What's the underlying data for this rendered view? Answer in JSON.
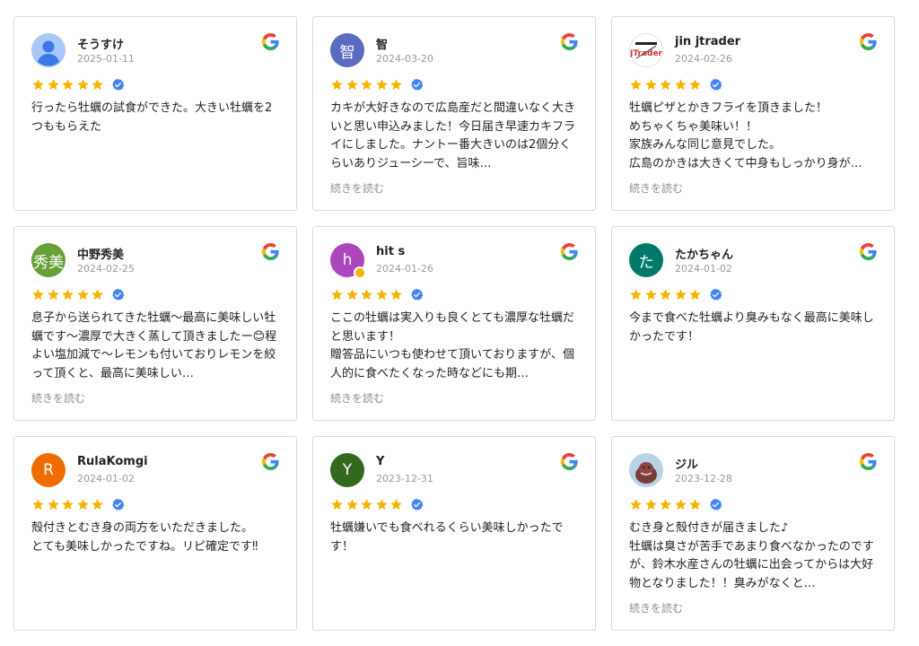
{
  "reviews": [
    {
      "name": "そうすけ",
      "date": "2025-01-11",
      "avatar": {
        "type": "default-user",
        "bg": "#a8c7fa",
        "initial": ""
      },
      "rating": 5,
      "text": "行ったら牡蠣の試食ができた。大きい牡蠣を2つももらえた",
      "read_more": ""
    },
    {
      "name": "智",
      "date": "2024-03-20",
      "avatar": {
        "type": "initial",
        "bg": "#5c6bc0",
        "initial": "智"
      },
      "rating": 5,
      "text": "カキが大好きなので広島産だと間違いなく大きいと思い申込みました！今日届き早速カキフライにしました。ナントー番大きいのは2個分くらいありジューシーで、旨味…",
      "read_more": "続きを読む"
    },
    {
      "name": "jin jtrader",
      "date": "2024-02-26",
      "avatar": {
        "type": "logo",
        "bg": "#ffffff",
        "initial": "JTrader"
      },
      "rating": 5,
      "text": "牡蠣ピザとかきフライを頂きました！\nめちゃくちゃ美味い！！\n家族みんな同じ意見でした。\n広島のかきは大きくて中身もしっかり身が…",
      "read_more": "続きを読む"
    },
    {
      "name": "中野秀美",
      "date": "2024-02-25",
      "avatar": {
        "type": "initial",
        "bg": "#689f38",
        "initial": "秀美"
      },
      "rating": 5,
      "text": "息子から送られてきた牡蠣〜最高に美味しい牡蠣です〜濃厚で大きく蒸して頂きましたー😊程よい塩加減で〜レモンも付いておりレモンを絞って頂くと、最高に美味しい…",
      "read_more": "続きを読む"
    },
    {
      "name": "hit s",
      "date": "2024-01-26",
      "avatar": {
        "type": "initial-badge",
        "bg": "#ab47bc",
        "initial": "h"
      },
      "rating": 5,
      "text": "ここの牡蠣は実入りも良くとても濃厚な牡蠣だと思います！\n贈答品にいつも使わせて頂いておりますが、個人的に食べたくなった時などにも期…",
      "read_more": "続きを読む"
    },
    {
      "name": "たかちゃん",
      "date": "2024-01-02",
      "avatar": {
        "type": "initial",
        "bg": "#00796b",
        "initial": "た"
      },
      "rating": 5,
      "text": "今まで食べた牡蠣より臭みもなく最高に美味しかったです！",
      "read_more": ""
    },
    {
      "name": "RulaKomgi",
      "date": "2024-01-02",
      "avatar": {
        "type": "initial",
        "bg": "#ef6c00",
        "initial": "R"
      },
      "rating": 5,
      "text": "殻付きとむき身の両方をいただきました。\nとても美味しかったですね。リピ確定です‼",
      "read_more": ""
    },
    {
      "name": "Y",
      "date": "2023-12-31",
      "avatar": {
        "type": "initial",
        "bg": "#33691e",
        "initial": "Y"
      },
      "rating": 5,
      "text": "牡蠣嫌いでも食べれるくらい美味しかったです！",
      "read_more": ""
    },
    {
      "name": "ジル",
      "date": "2023-12-28",
      "avatar": {
        "type": "photo",
        "bg": "#b7d3e8",
        "initial": ""
      },
      "rating": 5,
      "text": "むき身と殻付きが届きました♪\n牡蠣は臭さが苦手であまり食べなかったのですが、鈴木水産さんの牡蠣に出会ってからは大好物となりました！！臭みがなくと…",
      "read_more": "続きを読む"
    }
  ],
  "colors": {
    "star": "#f4b400",
    "verified": "#4285f4",
    "border": "#dadada"
  },
  "icons": {
    "source": "google-g-icon",
    "star": "star-icon",
    "verified": "verified-badge-icon"
  }
}
